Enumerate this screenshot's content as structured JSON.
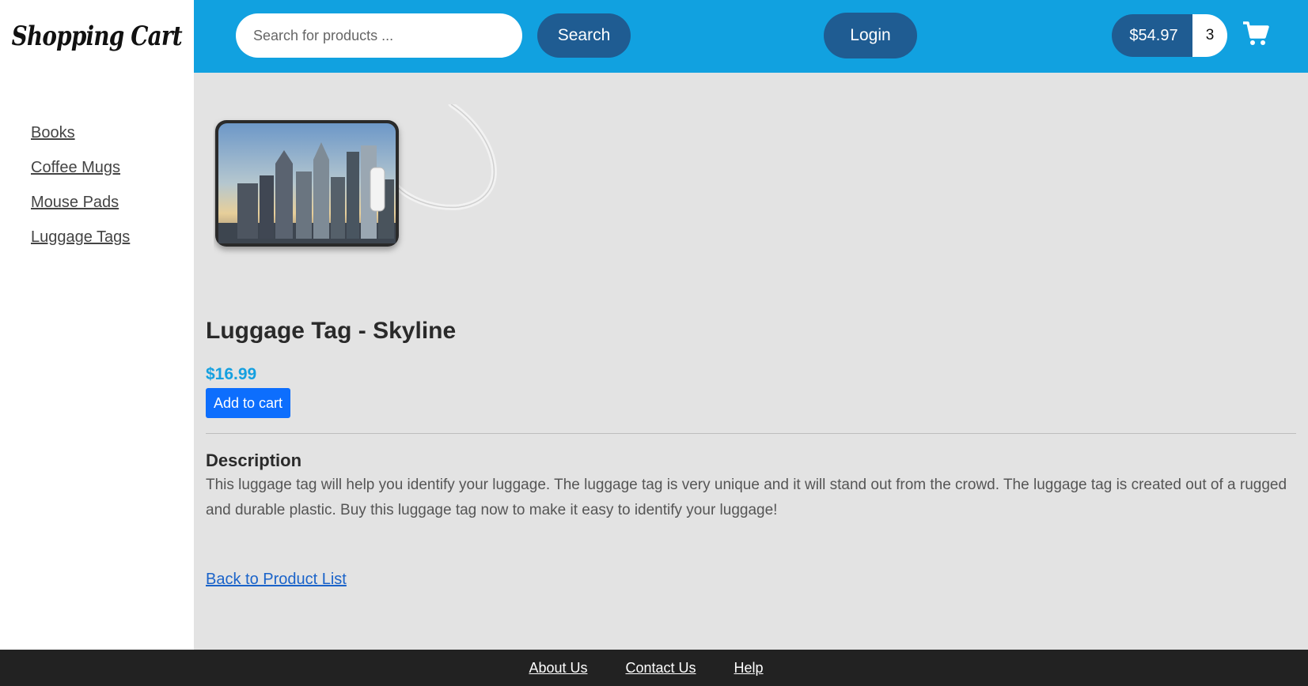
{
  "brand": {
    "logo_text": "Shopping Cart"
  },
  "header": {
    "search_placeholder": "Search for products ...",
    "search_label": "Search",
    "login_label": "Login",
    "cart_total": "$54.97",
    "cart_count": "3",
    "cart_icon": "shopping-cart-icon",
    "accent_color": "#11a1e0",
    "button_color": "#1f5c92"
  },
  "sidebar": {
    "categories": [
      "Books",
      "Coffee Mugs",
      "Mouse Pads",
      "Luggage Tags"
    ]
  },
  "product": {
    "image_icon": "luggage-tag-skyline-image",
    "title": "Luggage Tag - Skyline",
    "price": "$16.99",
    "add_to_cart_label": "Add to cart",
    "description_heading": "Description",
    "description": "This luggage tag will help you identify your luggage. The luggage tag is very unique and it will stand out from the crowd. The luggage tag is created out of a rugged and durable plastic. Buy this luggage tag now to make it easy to identify your luggage!",
    "back_link": "Back to Product List"
  },
  "footer": {
    "links": [
      "About Us",
      "Contact Us",
      "Help"
    ]
  }
}
